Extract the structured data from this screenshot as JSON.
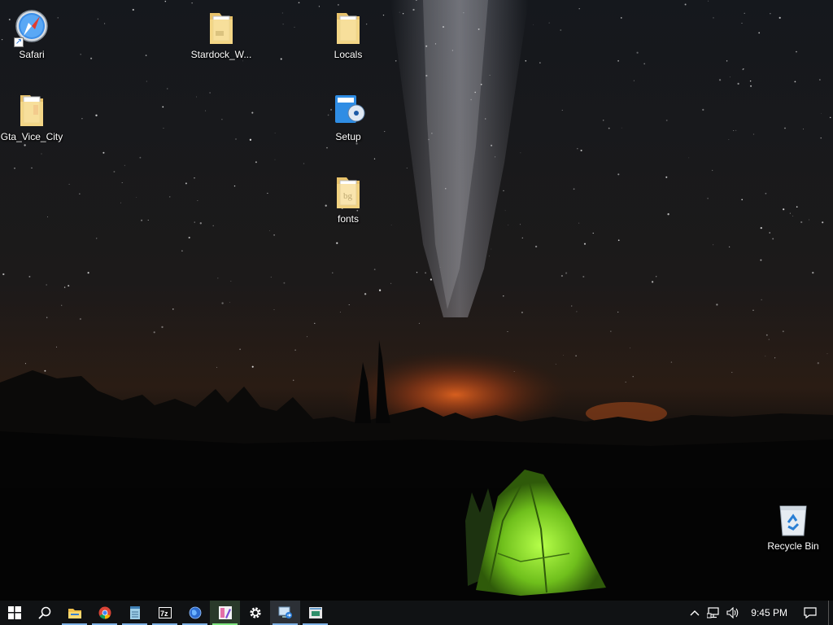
{
  "desktop": {
    "icons": [
      {
        "name": "Safari",
        "type": "app-shortcut"
      },
      {
        "name": "Stardock_W...",
        "type": "folder"
      },
      {
        "name": "Locals",
        "type": "folder"
      },
      {
        "name": "Gta_Vice_City",
        "type": "folder"
      },
      {
        "name": "Setup",
        "type": "installer"
      },
      {
        "name": "fonts",
        "type": "folder"
      },
      {
        "name": "Recycle Bin",
        "type": "recycle-bin"
      }
    ]
  },
  "taskbar": {
    "start_icon": "windows-logo-icon",
    "search_icon": "search-icon",
    "apps": [
      {
        "icon": "file-explorer-icon",
        "state": "running"
      },
      {
        "icon": "chrome-icon",
        "state": "running"
      },
      {
        "icon": "notepad-icon",
        "state": "running"
      },
      {
        "icon": "7zip-icon",
        "state": "running"
      },
      {
        "icon": "globe-icon",
        "state": "running"
      },
      {
        "icon": "paint-icon",
        "state": "active"
      },
      {
        "icon": "settings-gear-icon",
        "state": "idle"
      },
      {
        "icon": "remote-desktop-icon",
        "state": "active"
      },
      {
        "icon": "window-app-icon",
        "state": "running"
      }
    ],
    "tray": {
      "clock": "9:45 PM",
      "icons": [
        "chevron-up-icon",
        "network-icon",
        "volume-icon",
        "action-center-icon"
      ]
    }
  },
  "colors": {
    "taskbar_bg": "#101214",
    "running_indicator": "#7fb2e6",
    "tent_green": "#7dcf2a",
    "horizon_glow": "#d0561c"
  }
}
